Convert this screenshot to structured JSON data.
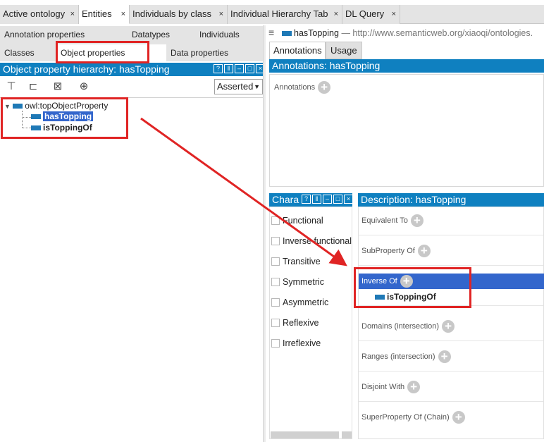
{
  "tabs": [
    {
      "label": "Active ontology",
      "active": false
    },
    {
      "label": "Entities",
      "active": true
    },
    {
      "label": "Individuals by class",
      "active": false
    },
    {
      "label": "Individual Hierarchy Tab",
      "active": false
    },
    {
      "label": "DL Query",
      "active": false
    }
  ],
  "tab_close": "×",
  "left": {
    "subtabs_row1": [
      "Annotation properties",
      "Datatypes",
      "Individuals"
    ],
    "subtabs_row2": [
      "Classes",
      "Object properties",
      "Data properties"
    ],
    "hierarchy_title": "Object property hierarchy: hasTopping",
    "asserted_select": "Asserted",
    "tree": {
      "root": "owl:topObjectProperty",
      "children": [
        "hasTopping",
        "isToppingOf"
      ]
    }
  },
  "right": {
    "entity_name": "hasTopping",
    "entity_iri": "— http://www.semanticweb.org/xiaoqi/ontologies.",
    "tabs": [
      "Annotations",
      "Usage"
    ],
    "annotations_title": "Annotations: hasTopping",
    "annotations_label": "Annotations",
    "characteristics_title": "Chara",
    "characteristics": [
      "Functional",
      "Inverse functional",
      "Transitive",
      "Symmetric",
      "Asymmetric",
      "Reflexive",
      "Irreflexive"
    ],
    "description_title": "Description: hasTopping",
    "description_sections": [
      "Equivalent To",
      "SubProperty Of",
      "Inverse Of",
      "Domains (intersection)",
      "Ranges (intersection)",
      "Disjoint With",
      "SuperProperty Of (Chain)"
    ],
    "inverse_of_value": "isToppingOf"
  },
  "colors": {
    "header_blue": "#0f80c0",
    "selection_blue": "#3366cc",
    "highlight_red": "#e02424",
    "property_icon": "#1f79b6"
  }
}
